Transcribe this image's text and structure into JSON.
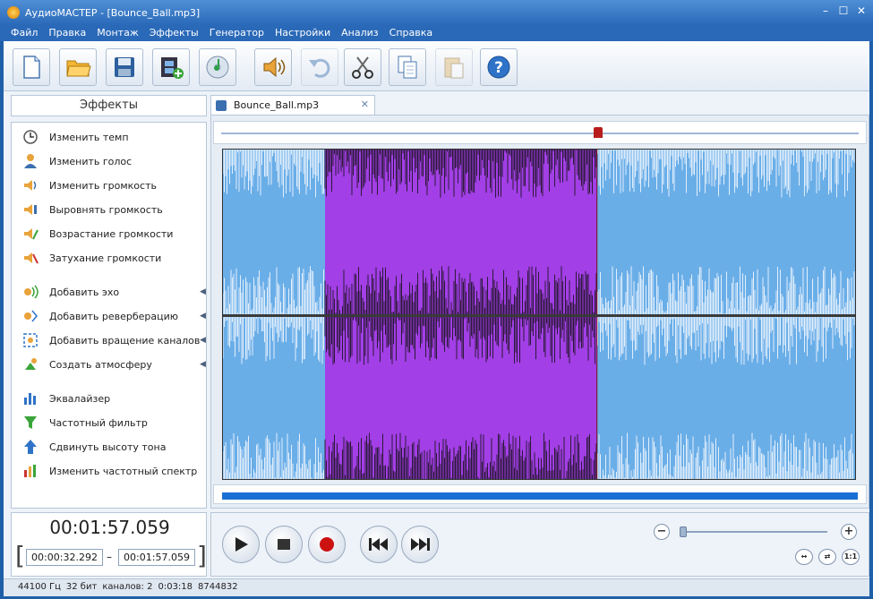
{
  "window": {
    "title": "АудиоМАСТЕР - [Bounce_Ball.mp3]",
    "minimize": "–",
    "maximize": "☐",
    "close": "✕"
  },
  "menu": [
    "Файл",
    "Правка",
    "Монтаж",
    "Эффекты",
    "Генератор",
    "Настройки",
    "Анализ",
    "Справка"
  ],
  "toolbar": {
    "buttons": [
      {
        "name": "new-file",
        "icon": "new-document-icon"
      },
      {
        "name": "open-file",
        "icon": "folder-open-icon"
      },
      {
        "name": "save-file",
        "icon": "floppy-disk-icon"
      },
      {
        "name": "add-video",
        "icon": "film-add-icon"
      },
      {
        "name": "cd-rip",
        "icon": "cd-music-icon"
      },
      {
        "name": "volume",
        "icon": "speaker-icon"
      },
      {
        "name": "undo",
        "icon": "undo-icon"
      },
      {
        "name": "cut",
        "icon": "scissors-icon"
      },
      {
        "name": "copy",
        "icon": "copy-icon"
      },
      {
        "name": "paste",
        "icon": "paste-icon"
      },
      {
        "name": "help",
        "icon": "help-icon"
      }
    ]
  },
  "effects": {
    "header": "Эффекты",
    "items": [
      {
        "label": "Изменить темп",
        "icon": "clock-icon"
      },
      {
        "label": "Изменить голос",
        "icon": "person-voice-icon"
      },
      {
        "label": "Изменить громкость",
        "icon": "speaker-volume-icon"
      },
      {
        "label": "Выровнять громкость",
        "icon": "volume-level-icon"
      },
      {
        "label": "Возрастание громкости",
        "icon": "fade-in-icon"
      },
      {
        "label": "Затухание громкости",
        "icon": "fade-out-icon"
      },
      {
        "label": "Добавить эхо",
        "icon": "echo-icon"
      },
      {
        "label": "Добавить реверберацию",
        "icon": "reverb-icon"
      },
      {
        "label": "Добавить вращение каналов",
        "icon": "channel-rotate-icon"
      },
      {
        "label": "Создать атмосферу",
        "icon": "atmosphere-icon"
      },
      {
        "label": "Эквалайзер",
        "icon": "equalizer-icon"
      },
      {
        "label": "Частотный фильтр",
        "icon": "filter-funnel-icon"
      },
      {
        "label": "Сдвинуть высоту тона",
        "icon": "pitch-up-icon"
      },
      {
        "label": "Изменить частотный спектр",
        "icon": "spectrum-icon"
      }
    ]
  },
  "time": {
    "current": "00:01:57.059",
    "selection_start": "00:00:32.292",
    "selection_end": "00:01:57.059",
    "dash": "–",
    "bracket_open": "[",
    "bracket_close": "]"
  },
  "tab": {
    "label": "Bounce_Ball.mp3",
    "close": "✕"
  },
  "waveform": {
    "background": "#6aaee8",
    "selection_color": "#a23fe6",
    "selection_fraction": [
      0.161,
      0.59
    ],
    "playhead_fraction": 0.59
  },
  "zoom": {
    "minus": "−",
    "plus": "+",
    "level_fraction": 0.0
  },
  "status": {
    "rate": "44100 Гц",
    "bits": "32 бит",
    "channels": "каналов: 2",
    "duration": "0:03:18",
    "samples": "8744832"
  },
  "colors": {
    "accent": "#1a6fd4",
    "title_bar": "#2a69b8",
    "record": "#cc1111"
  }
}
